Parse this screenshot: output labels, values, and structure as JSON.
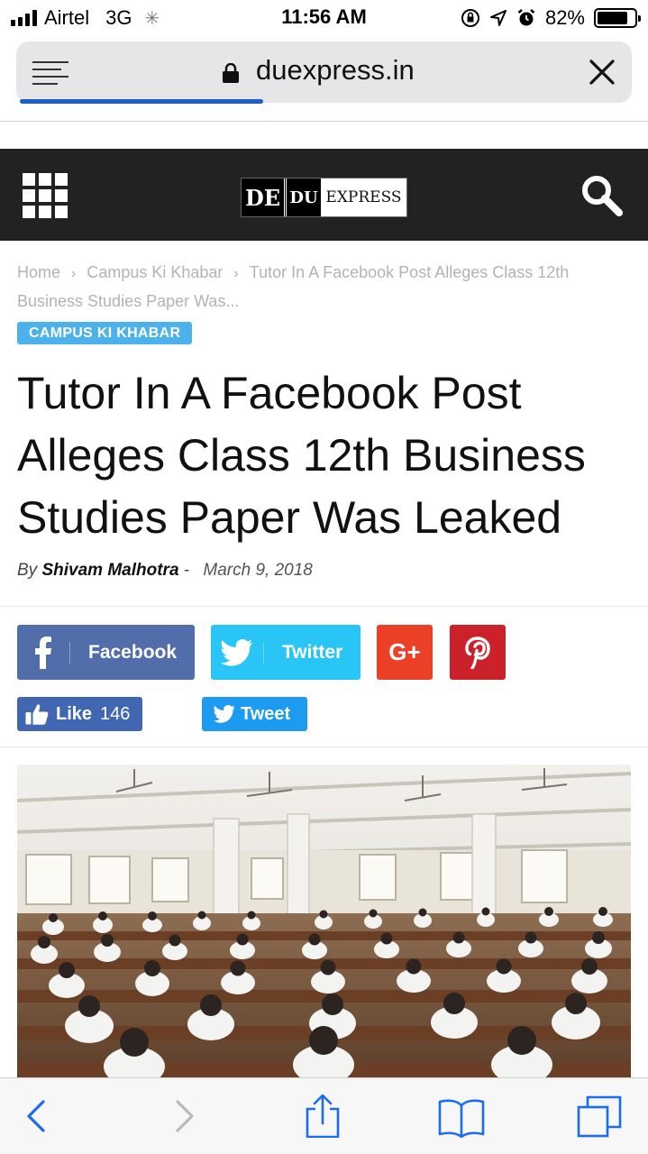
{
  "status_bar": {
    "carrier": "Airtel",
    "network": "3G",
    "time": "11:56 AM",
    "battery_percent": "82%",
    "battery_level": 0.82
  },
  "browser": {
    "url": "duexpress.in",
    "load_progress": 0.4
  },
  "site": {
    "logo_de": "DE",
    "logo_du": "DU",
    "logo_express": "EXPRESS"
  },
  "breadcrumb": {
    "items": [
      "Home",
      "Campus Ki Khabar",
      "Tutor In A Facebook Post Alleges Class 12th Business Studies Paper Was..."
    ],
    "separator": "›"
  },
  "article": {
    "category": "CAMPUS KI KHABAR",
    "title": "Tutor In A Facebook Post Alleges Class 12th Business Studies Paper Was Leaked",
    "by_label": "By",
    "author": "Shivam Malhotra",
    "author_sep": "-",
    "date": "March 9, 2018"
  },
  "share": {
    "facebook_label": "Facebook",
    "twitter_label": "Twitter",
    "googleplus_label": "G+",
    "like_label": "Like",
    "like_count": "146",
    "tweet_label": "Tweet"
  },
  "colors": {
    "header_bg": "#222222",
    "category_badge": "#4db2ec",
    "facebook": "#516eab",
    "twitter": "#29c5f6",
    "googleplus": "#eb4026",
    "pinterest": "#ca212a",
    "fb_like": "#4267b2",
    "tweet": "#1d9bf0",
    "progress": "#1a5fd1"
  },
  "icons": {
    "address_menu": "reader-menu-icon",
    "lock": "lock-icon",
    "close": "close-icon",
    "site_menu": "grid-menu-icon",
    "search": "search-icon",
    "toolbar": [
      "back-icon",
      "forward-icon",
      "share-icon",
      "bookmarks-icon",
      "tabs-icon"
    ]
  }
}
